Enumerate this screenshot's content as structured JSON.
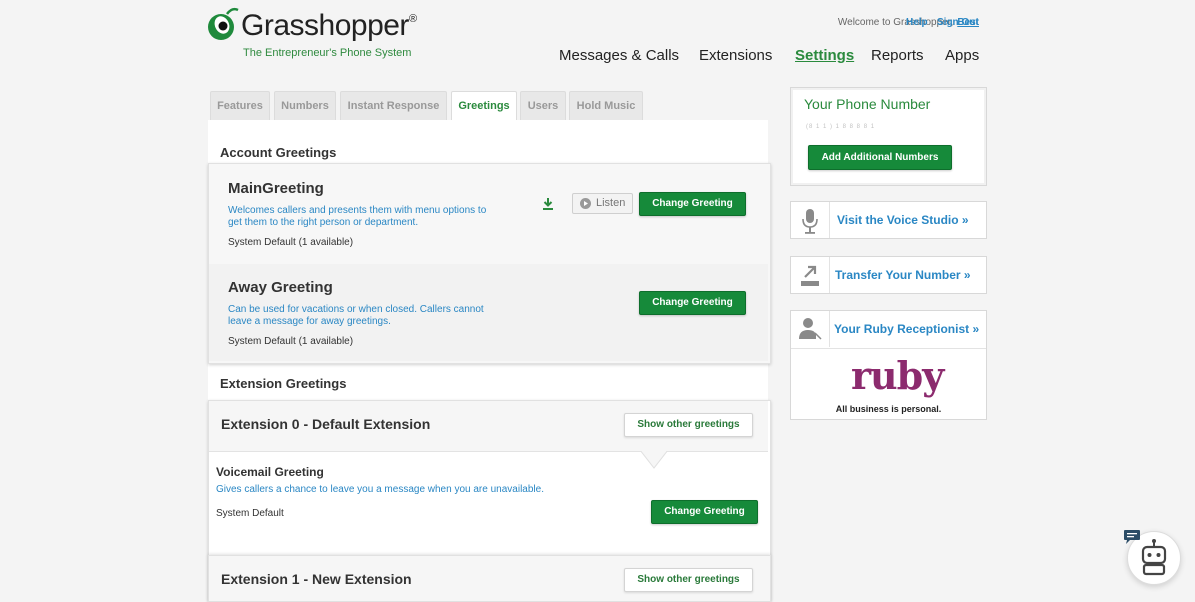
{
  "brand": {
    "name": "Grasshopper",
    "reg": "®",
    "tagline": "The Entrepreneur's Phone System"
  },
  "header": {
    "welcome_text": "Welcome to Grasshopper,",
    "user_name": "Best",
    "help": "Help",
    "sign_out": "Sign Out"
  },
  "nav": {
    "messages": "Messages & Calls",
    "extensions": "Extensions",
    "settings": "Settings",
    "reports": "Reports",
    "apps": "Apps",
    "active": "Settings"
  },
  "tabs": {
    "features": "Features",
    "numbers": "Numbers",
    "instant": "Instant Response",
    "greetings": "Greetings",
    "users": "Users",
    "hold": "Hold Music",
    "active": "Greetings"
  },
  "account": {
    "heading": "Account Greetings",
    "main": {
      "title": "MainGreeting",
      "desc": "Welcomes callers and presents them with menu options to get them to the right person or department.",
      "status": "System Default (1 available)",
      "listen": "Listen",
      "change": "Change Greeting"
    },
    "away": {
      "title": "Away Greeting",
      "desc": "Can be used for vacations or when closed. Callers cannot leave a message for away greetings.",
      "status": "System Default (1 available)",
      "change": "Change Greeting"
    }
  },
  "extensions": {
    "heading": "Extension Greetings",
    "ext0": {
      "title": "Extension 0 - Default Extension",
      "show_other": "Show other greetings",
      "voicemail": {
        "title": "Voicemail Greeting",
        "desc": "Gives callers a chance to leave you a message when you are unavailable.",
        "status": "System Default",
        "change": "Change Greeting"
      }
    },
    "ext1": {
      "title": "Extension 1 - New Extension",
      "show_other": "Show other greetings"
    }
  },
  "sidebar": {
    "phone": {
      "heading": "Your Phone Number",
      "value": "(8 1 1 )    1 8 8      8 8 1",
      "add_button": "Add Additional Numbers"
    },
    "voice_studio": "Visit the Voice Studio »",
    "transfer": "Transfer Your Number »",
    "ruby": {
      "label": "Your Ruby Receptionist »",
      "logo": "ruby",
      "tagline": "All business is personal."
    }
  },
  "colors": {
    "brand_green": "#168a3a",
    "link_blue": "#2a87c4",
    "ruby_purple": "#8c2b6e"
  },
  "icons": [
    "grasshopper-logo-icon",
    "download-icon",
    "play-icon",
    "microphone-icon",
    "transfer-icon",
    "person-icon",
    "chatbot-icon",
    "chat-bubble-icon"
  ]
}
